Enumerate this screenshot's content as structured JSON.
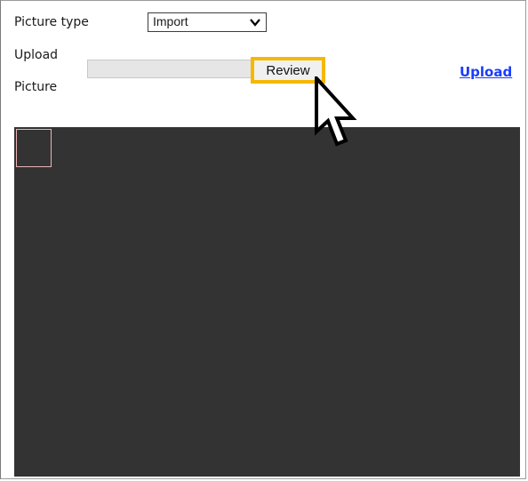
{
  "form": {
    "picture_type_label": "Picture type",
    "picture_type_value": "Import",
    "upload_picture_label_line1": "Upload",
    "upload_picture_label_line2": "Picture",
    "file_input_value": "",
    "review_button_label": "Review",
    "upload_link_label": "Upload"
  },
  "colors": {
    "highlight": "#f5b800",
    "canvas_background": "#333333",
    "link": "#1a3cff"
  },
  "icons": {
    "select_chevron": "chevron-down-icon",
    "pointer": "mouse-pointer-icon"
  }
}
